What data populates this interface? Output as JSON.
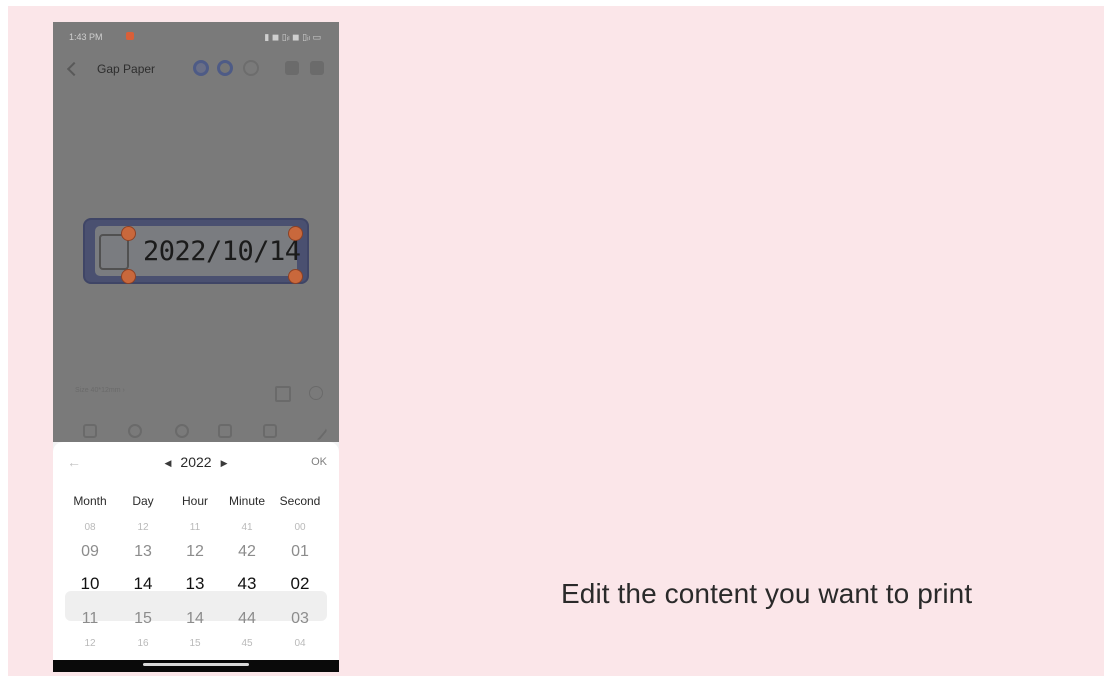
{
  "caption": "Edit the content you want to print",
  "status_bar": {
    "time": "1:43 PM",
    "indicators": "▮ ◼ ▯ᵢₗ ◼ ▯ᵢₗ ▭"
  },
  "toolbar": {
    "title": "Gap Paper"
  },
  "canvas": {
    "label_text": "2022/10/14",
    "size_text": "Size 40*12mm ›"
  },
  "picker": {
    "year": "2022",
    "ok_label": "OK",
    "columns": [
      "Month",
      "Day",
      "Hour",
      "Minute",
      "Second"
    ],
    "wheels": {
      "month": [
        "08",
        "09",
        "10",
        "11",
        "12"
      ],
      "day": [
        "12",
        "13",
        "14",
        "15",
        "16"
      ],
      "hour": [
        "11",
        "12",
        "13",
        "14",
        "15"
      ],
      "minute": [
        "41",
        "42",
        "43",
        "44",
        "45"
      ],
      "second": [
        "00",
        "01",
        "02",
        "03",
        "04"
      ]
    },
    "selected": {
      "month": "10",
      "day": "14",
      "hour": "13",
      "minute": "43",
      "second": "02"
    }
  },
  "colors": {
    "page_background": "#fbe6e9",
    "handle": "#c9683c",
    "label_frame": "#4a5070"
  }
}
